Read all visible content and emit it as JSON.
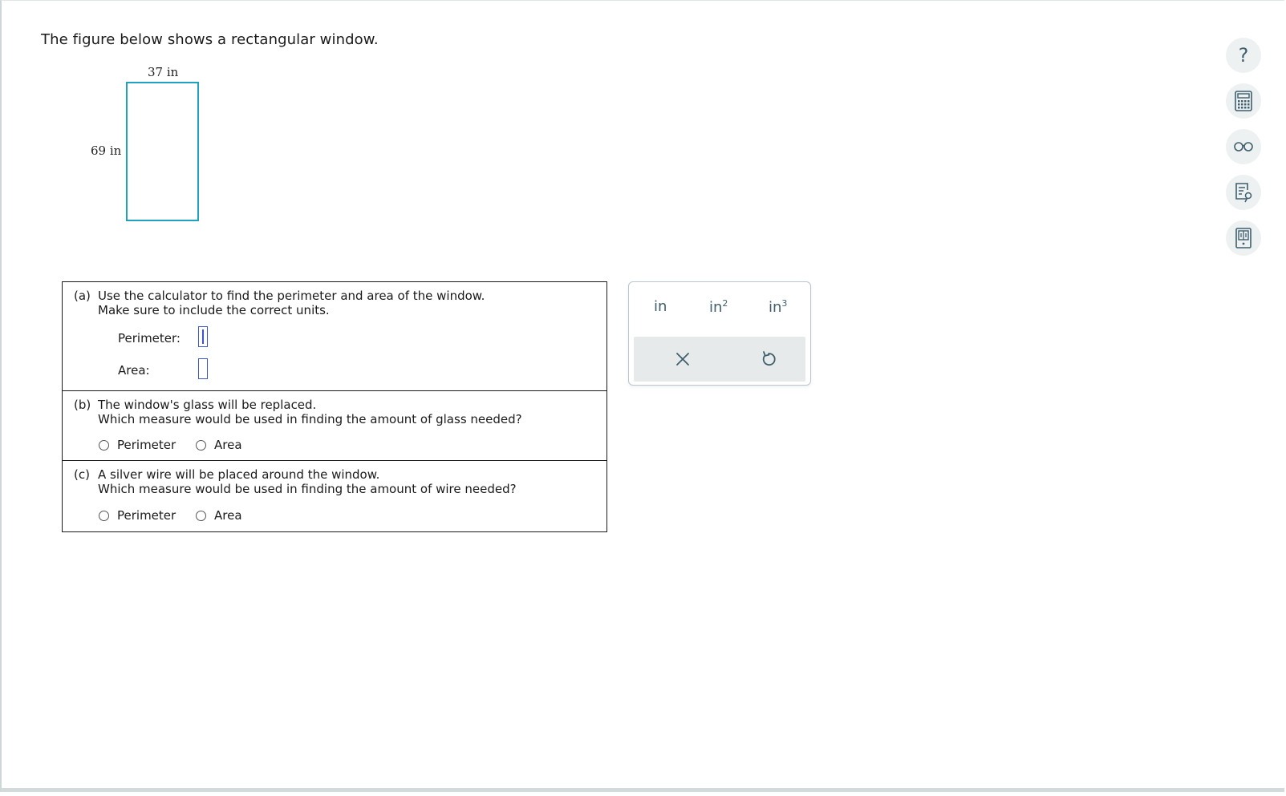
{
  "intro": "The figure below shows a rectangular window.",
  "figure": {
    "width_label": "37 in",
    "height_label": "69 in",
    "stroke_color": "#1fa2bf"
  },
  "part_a": {
    "letter": "(a)",
    "line1": "Use the calculator to find the perimeter and area of the window.",
    "line2": "Make sure to include the correct units.",
    "perimeter_label": "Perimeter:",
    "perimeter_value": "",
    "area_label": "Area:",
    "area_value": ""
  },
  "part_b": {
    "letter": "(b)",
    "line1": "The window's glass will be replaced.",
    "line2": "Which measure would be used in finding the amount of glass needed?",
    "options": [
      "Perimeter",
      "Area"
    ]
  },
  "part_c": {
    "letter": "(c)",
    "line1": "A silver wire will be placed around the window.",
    "line2": "Which measure would be used in finding the amount of wire needed?",
    "options": [
      "Perimeter",
      "Area"
    ]
  },
  "units": {
    "in": "in",
    "in2_base": "in",
    "in2_exp": "2",
    "in3_base": "in",
    "in3_exp": "3"
  },
  "tools": {
    "help": "?"
  },
  "colors": {
    "input_border": "#3b54d6",
    "unit_text": "#3f5f6d",
    "tool_bg": "#edf1f2"
  }
}
